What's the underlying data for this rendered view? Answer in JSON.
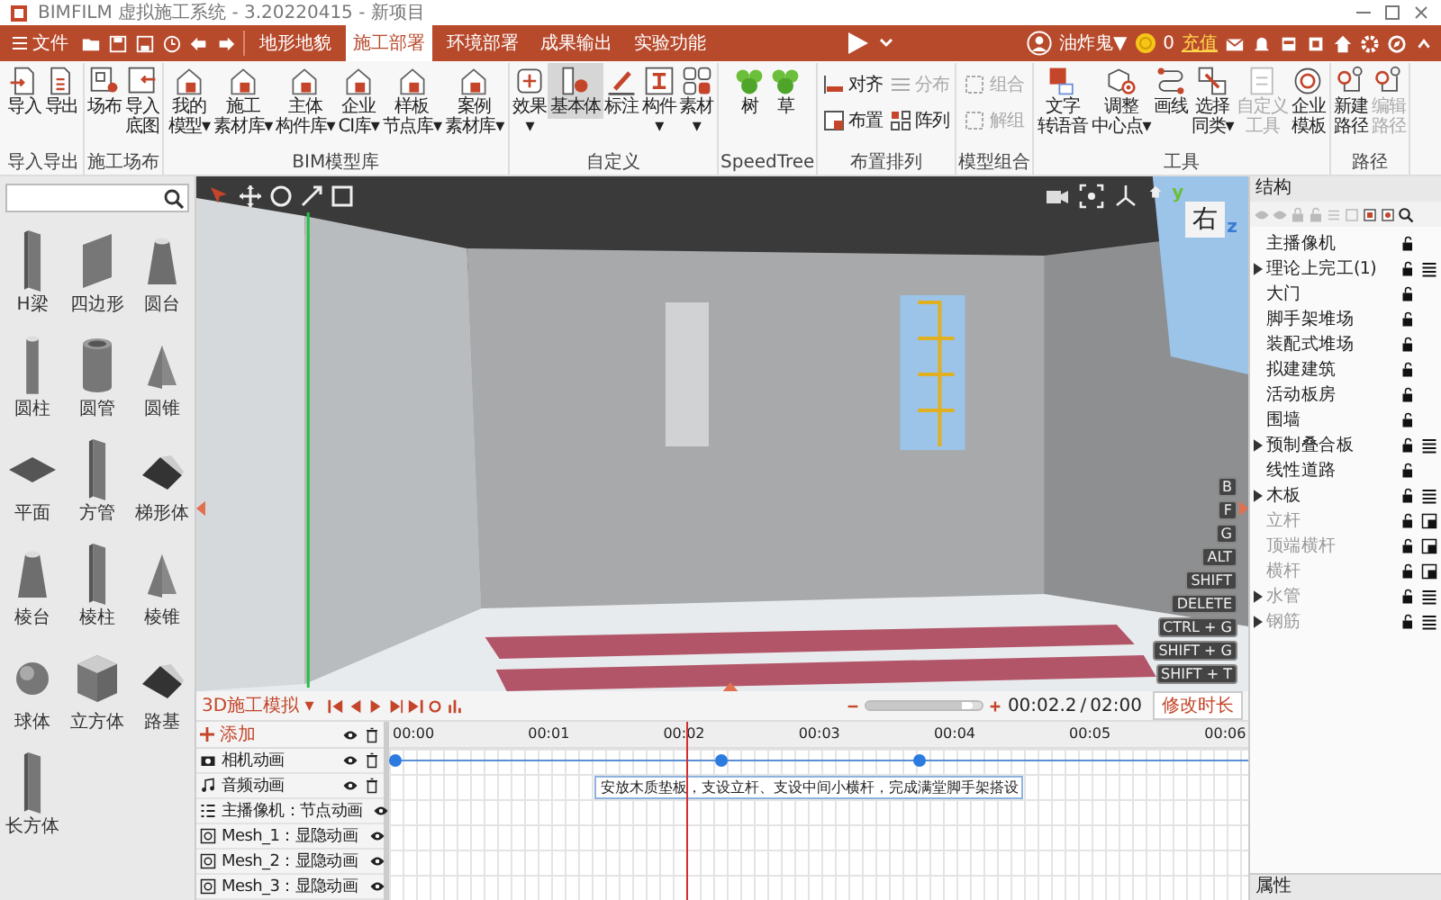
{
  "window": {
    "title": "BIMFILM 虚拟施工系统 - 3.20220415 - 新项目"
  },
  "menu": {
    "file": "文件",
    "tabs": [
      {
        "label": "地形地貌",
        "selected": false
      },
      {
        "label": "施工部署",
        "selected": true
      },
      {
        "label": "环境部署",
        "selected": false
      },
      {
        "label": "成果输出",
        "selected": false
      },
      {
        "label": "实验功能",
        "selected": false
      }
    ]
  },
  "account": {
    "user": "油炸鬼▼",
    "coins": "0",
    "recharge": "充值"
  },
  "ribbon": {
    "groups": [
      {
        "label": "导入导出",
        "buttons": [
          {
            "kind": "large",
            "lines": [
              "导入"
            ],
            "selected": false,
            "disabled": false
          },
          {
            "kind": "large",
            "lines": [
              "导出"
            ],
            "selected": false,
            "disabled": false
          }
        ]
      },
      {
        "label": "施工场布",
        "buttons": [
          {
            "kind": "large",
            "lines": [
              "场布"
            ],
            "selected": false,
            "disabled": false
          },
          {
            "kind": "large",
            "lines": [
              "导入",
              "底图"
            ],
            "selected": false,
            "disabled": false
          }
        ]
      },
      {
        "label": "BIM模型库",
        "buttons": [
          {
            "kind": "large",
            "lines": [
              "我的",
              "模型▾"
            ],
            "selected": false,
            "disabled": false
          },
          {
            "kind": "large",
            "lines": [
              "施工",
              "素材库▾"
            ],
            "selected": false,
            "disabled": false
          },
          {
            "kind": "large",
            "lines": [
              "主体",
              "构件库▾"
            ],
            "selected": false,
            "disabled": false
          },
          {
            "kind": "large",
            "lines": [
              "企业",
              "CI库▾"
            ],
            "selected": false,
            "disabled": false
          },
          {
            "kind": "large",
            "lines": [
              "样板",
              "节点库▾"
            ],
            "selected": false,
            "disabled": false
          },
          {
            "kind": "large",
            "lines": [
              "案例",
              "素材库▾"
            ],
            "selected": false,
            "disabled": false
          }
        ]
      },
      {
        "label": "自定义",
        "buttons": [
          {
            "kind": "large",
            "lines": [
              "效果",
              "▾"
            ],
            "selected": false,
            "disabled": false
          },
          {
            "kind": "large",
            "lines": [
              "基本体"
            ],
            "selected": true,
            "disabled": false
          },
          {
            "kind": "large",
            "lines": [
              "标注"
            ],
            "selected": false,
            "disabled": false
          },
          {
            "kind": "large",
            "lines": [
              "构件",
              "▾"
            ],
            "selected": false,
            "disabled": false
          },
          {
            "kind": "large",
            "lines": [
              "素材",
              "▾"
            ],
            "selected": false,
            "disabled": false
          }
        ]
      },
      {
        "label": "SpeedTree",
        "buttons": [
          {
            "kind": "large",
            "lines": [
              "树"
            ],
            "selected": false,
            "disabled": false
          },
          {
            "kind": "large",
            "lines": [
              "草"
            ],
            "selected": false,
            "disabled": false
          }
        ]
      },
      {
        "label": "布置排列",
        "buttons": [
          {
            "kind": "small",
            "lines": [
              "对齐"
            ],
            "selected": false,
            "disabled": false
          },
          {
            "kind": "small",
            "lines": [
              "布置"
            ],
            "selected": false,
            "disabled": false
          },
          {
            "kind": "small",
            "lines": [
              "分布"
            ],
            "selected": false,
            "disabled": true
          },
          {
            "kind": "small",
            "lines": [
              "阵列"
            ],
            "selected": false,
            "disabled": false
          }
        ]
      },
      {
        "label": "模型组合",
        "buttons": [
          {
            "kind": "small",
            "lines": [
              "组合"
            ],
            "selected": false,
            "disabled": true
          },
          {
            "kind": "small",
            "lines": [
              "解组"
            ],
            "selected": false,
            "disabled": true
          }
        ]
      },
      {
        "label": "工具",
        "buttons": [
          {
            "kind": "large",
            "lines": [
              "文字",
              "转语音"
            ],
            "selected": false,
            "disabled": false
          },
          {
            "kind": "large",
            "lines": [
              "调整",
              "中心点▾"
            ],
            "selected": false,
            "disabled": false
          },
          {
            "kind": "large",
            "lines": [
              "画线"
            ],
            "selected": false,
            "disabled": false
          },
          {
            "kind": "large",
            "lines": [
              "选择",
              "同类▾"
            ],
            "selected": false,
            "disabled": false
          },
          {
            "kind": "large",
            "lines": [
              "自定义",
              "工具"
            ],
            "selected": false,
            "disabled": true
          },
          {
            "kind": "large",
            "lines": [
              "企业",
              "模板"
            ],
            "selected": false,
            "disabled": false
          }
        ]
      },
      {
        "label": "路径",
        "buttons": [
          {
            "kind": "large",
            "lines": [
              "新建",
              "路径"
            ],
            "selected": false,
            "disabled": false
          },
          {
            "kind": "large",
            "lines": [
              "编辑",
              "路径"
            ],
            "selected": false,
            "disabled": true
          }
        ]
      }
    ]
  },
  "library": {
    "items": [
      {
        "label": "H梁"
      },
      {
        "label": "四边形"
      },
      {
        "label": "圆台"
      },
      {
        "label": "圆柱"
      },
      {
        "label": "圆管"
      },
      {
        "label": "圆锥"
      },
      {
        "label": "平面"
      },
      {
        "label": "方管"
      },
      {
        "label": "梯形体"
      },
      {
        "label": "棱台"
      },
      {
        "label": "棱柱"
      },
      {
        "label": "棱锥"
      },
      {
        "label": "球体"
      },
      {
        "label": "立方体"
      },
      {
        "label": "路基"
      },
      {
        "label": "长方体"
      }
    ]
  },
  "viewport": {
    "view_cube": "右",
    "axes": [
      "y",
      "z"
    ],
    "shortcuts": [
      "B",
      "F",
      "G",
      "ALT",
      "SHIFT",
      "DELETE",
      "CTRL + G",
      "SHIFT + G",
      "SHIFT + T"
    ]
  },
  "structure": {
    "title": "结构",
    "items": [
      {
        "label": "主播像机",
        "has_children": false,
        "dimmed": false
      },
      {
        "label": "理论上完工(1)",
        "has_children": true,
        "dimmed": false
      },
      {
        "label": "大门",
        "has_children": false,
        "dimmed": false
      },
      {
        "label": "脚手架堆场",
        "has_children": false,
        "dimmed": false
      },
      {
        "label": "装配式堆场",
        "has_children": false,
        "dimmed": false
      },
      {
        "label": "拟建建筑",
        "has_children": false,
        "dimmed": false
      },
      {
        "label": "活动板房",
        "has_children": false,
        "dimmed": false
      },
      {
        "label": "围墙",
        "has_children": false,
        "dimmed": false
      },
      {
        "label": "预制叠合板",
        "has_children": true,
        "dimmed": false
      },
      {
        "label": "线性道路",
        "has_children": false,
        "dimmed": false
      },
      {
        "label": "木板",
        "has_children": true,
        "dimmed": false
      },
      {
        "label": "立杆",
        "has_children": false,
        "dimmed": true
      },
      {
        "label": "顶端横杆",
        "has_children": false,
        "dimmed": true
      },
      {
        "label": "横杆",
        "has_children": false,
        "dimmed": true
      },
      {
        "label": "水管",
        "has_children": true,
        "dimmed": true
      },
      {
        "label": "钢筋",
        "has_children": true,
        "dimmed": true
      }
    ]
  },
  "properties": {
    "title": "属性"
  },
  "timeline": {
    "mode": "3D施工模拟 ▾",
    "zoom": {
      "level": 0.92
    },
    "current": "00:02.2",
    "separator": "/",
    "duration": "02:00",
    "edit_duration": "修改时长",
    "add": "添加",
    "ruler": [
      "00:00",
      "00:01",
      "00:02",
      "00:03",
      "00:04",
      "00:05",
      "00:06"
    ],
    "playhead": {
      "level": 0.346
    },
    "tracks": [
      {
        "label": "相机动画"
      },
      {
        "label": "音频动画"
      },
      {
        "label": "主播像机：节点动画"
      },
      {
        "label": "Mesh_1：显隐动画"
      },
      {
        "label": "Mesh_2：显隐动画"
      },
      {
        "label": "Mesh_3：显隐动画"
      }
    ],
    "keyframes": [
      {
        "level": 0.0
      },
      {
        "level": 0.38
      },
      {
        "level": 0.61
      }
    ],
    "caption": {
      "text": "安放木质垫板，支设立杆、支设中间小横杆，完成满堂脚手架搭设"
    }
  }
}
